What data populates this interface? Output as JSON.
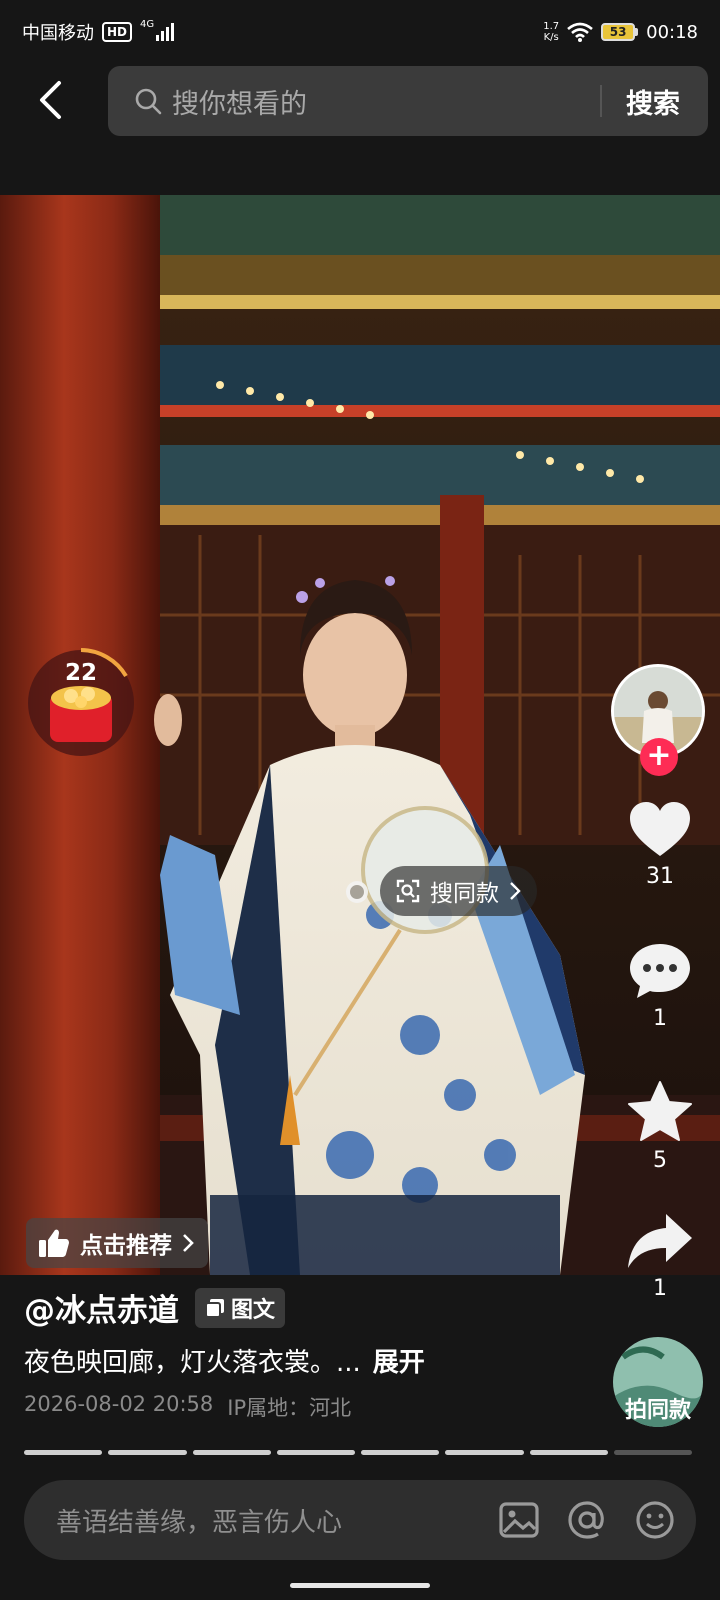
{
  "status_bar": {
    "carrier": "中国移动",
    "hd": "HD",
    "network": "4G",
    "speed_value": "1.7",
    "speed_unit": "K/s",
    "battery": "53",
    "time": "00:18"
  },
  "search": {
    "placeholder": "搜你想看的",
    "submit_label": "搜索"
  },
  "reward": {
    "count": "22"
  },
  "actions": {
    "likes": "31",
    "comments": "1",
    "favorites": "5",
    "shares": "1"
  },
  "find_same": {
    "label": "搜同款"
  },
  "recommend": {
    "label": "点击推荐"
  },
  "post": {
    "author": "@冰点赤道",
    "type_badge": "图文",
    "caption": "夜色映回廊，灯火落衣裳。...",
    "expand_label": "展开",
    "timestamp": "2026-08-02 20:58",
    "ip_location": "IP属地：河北",
    "same_style_label": "拍同款",
    "image_count": 8,
    "current_image": 7
  },
  "comment_bar": {
    "placeholder": "善语结善缘，恶言伤人心"
  },
  "colors": {
    "accent_red": "#fe2c55",
    "background": "#161616",
    "battery_fill": "#e8c43a"
  },
  "icons": [
    "back-arrow-icon",
    "search-icon",
    "thumbs-up-icon",
    "heart-icon",
    "comment-icon",
    "star-icon",
    "share-icon",
    "image-icon",
    "at-icon",
    "emoji-icon"
  ]
}
